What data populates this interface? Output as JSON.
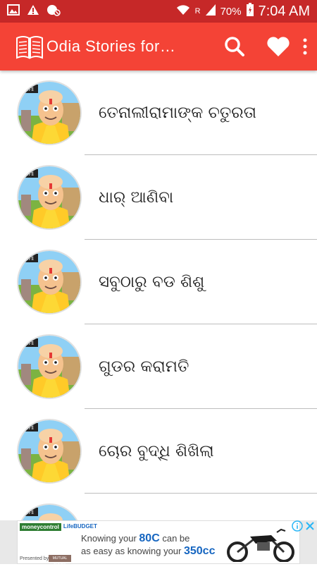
{
  "status": {
    "battery_percent": "70%",
    "time": "7:04 AM",
    "signal_label": "R"
  },
  "appbar": {
    "title": "Odia Stories for…"
  },
  "stories": [
    {
      "title": "ତେନାଲୀରାମାଙ୍କ ଚତୁରତା"
    },
    {
      "title": "ଧାର୍ ଆଣିବା"
    },
    {
      "title": "ସବୁଠାରୁ ବଡ ଶିଶୁ"
    },
    {
      "title": "ଗୁଡର କରାମତି"
    },
    {
      "title": "ଚୋର ବୁଦ୍ଧି ଶିଖିଲା"
    },
    {
      "title": ""
    }
  ],
  "avatar_badge": "ରାମୀ",
  "ad": {
    "brand1": "moneycontrol",
    "brand2": "LifeBUDGET",
    "line1_pre": "Knowing your ",
    "line1_hl": "80C",
    "line1_post": " can be",
    "line2_pre": "as easy as knowing your ",
    "line2_hl": "350cc",
    "presented": "Presented by",
    "sponsor": "MUTUAL FUNDS"
  },
  "colors": {
    "statusbar": "#c62828",
    "appbar": "#f44336",
    "accent_blue": "#1565c0"
  }
}
